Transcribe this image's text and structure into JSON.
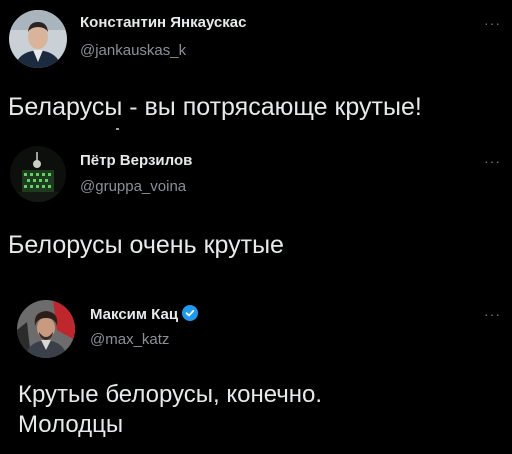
{
  "colors": {
    "background": "#000000",
    "primary_text": "#e7e9ea",
    "secondary_text": "#8b9096",
    "verified_badge": "#1d9bf0"
  },
  "tweets": [
    {
      "name": "Константин Янкаускас",
      "handle": "@jankauskas_k",
      "text": "Беларусы - вы потрясающе крутые!",
      "more_icon": "more-dots-icon"
    },
    {
      "name": "Пётр Верзилов",
      "handle": "@gruppa_voina",
      "text": "Белорусы очень крутые",
      "more_icon": "more-dots-icon"
    },
    {
      "name": "Максим Кац",
      "handle": "@max_katz",
      "verified_icon": "verified-badge-icon",
      "text_lines": [
        "Крутые белорусы, конечно.",
        "Молодцы"
      ],
      "more_icon": "more-dots-icon"
    }
  ]
}
